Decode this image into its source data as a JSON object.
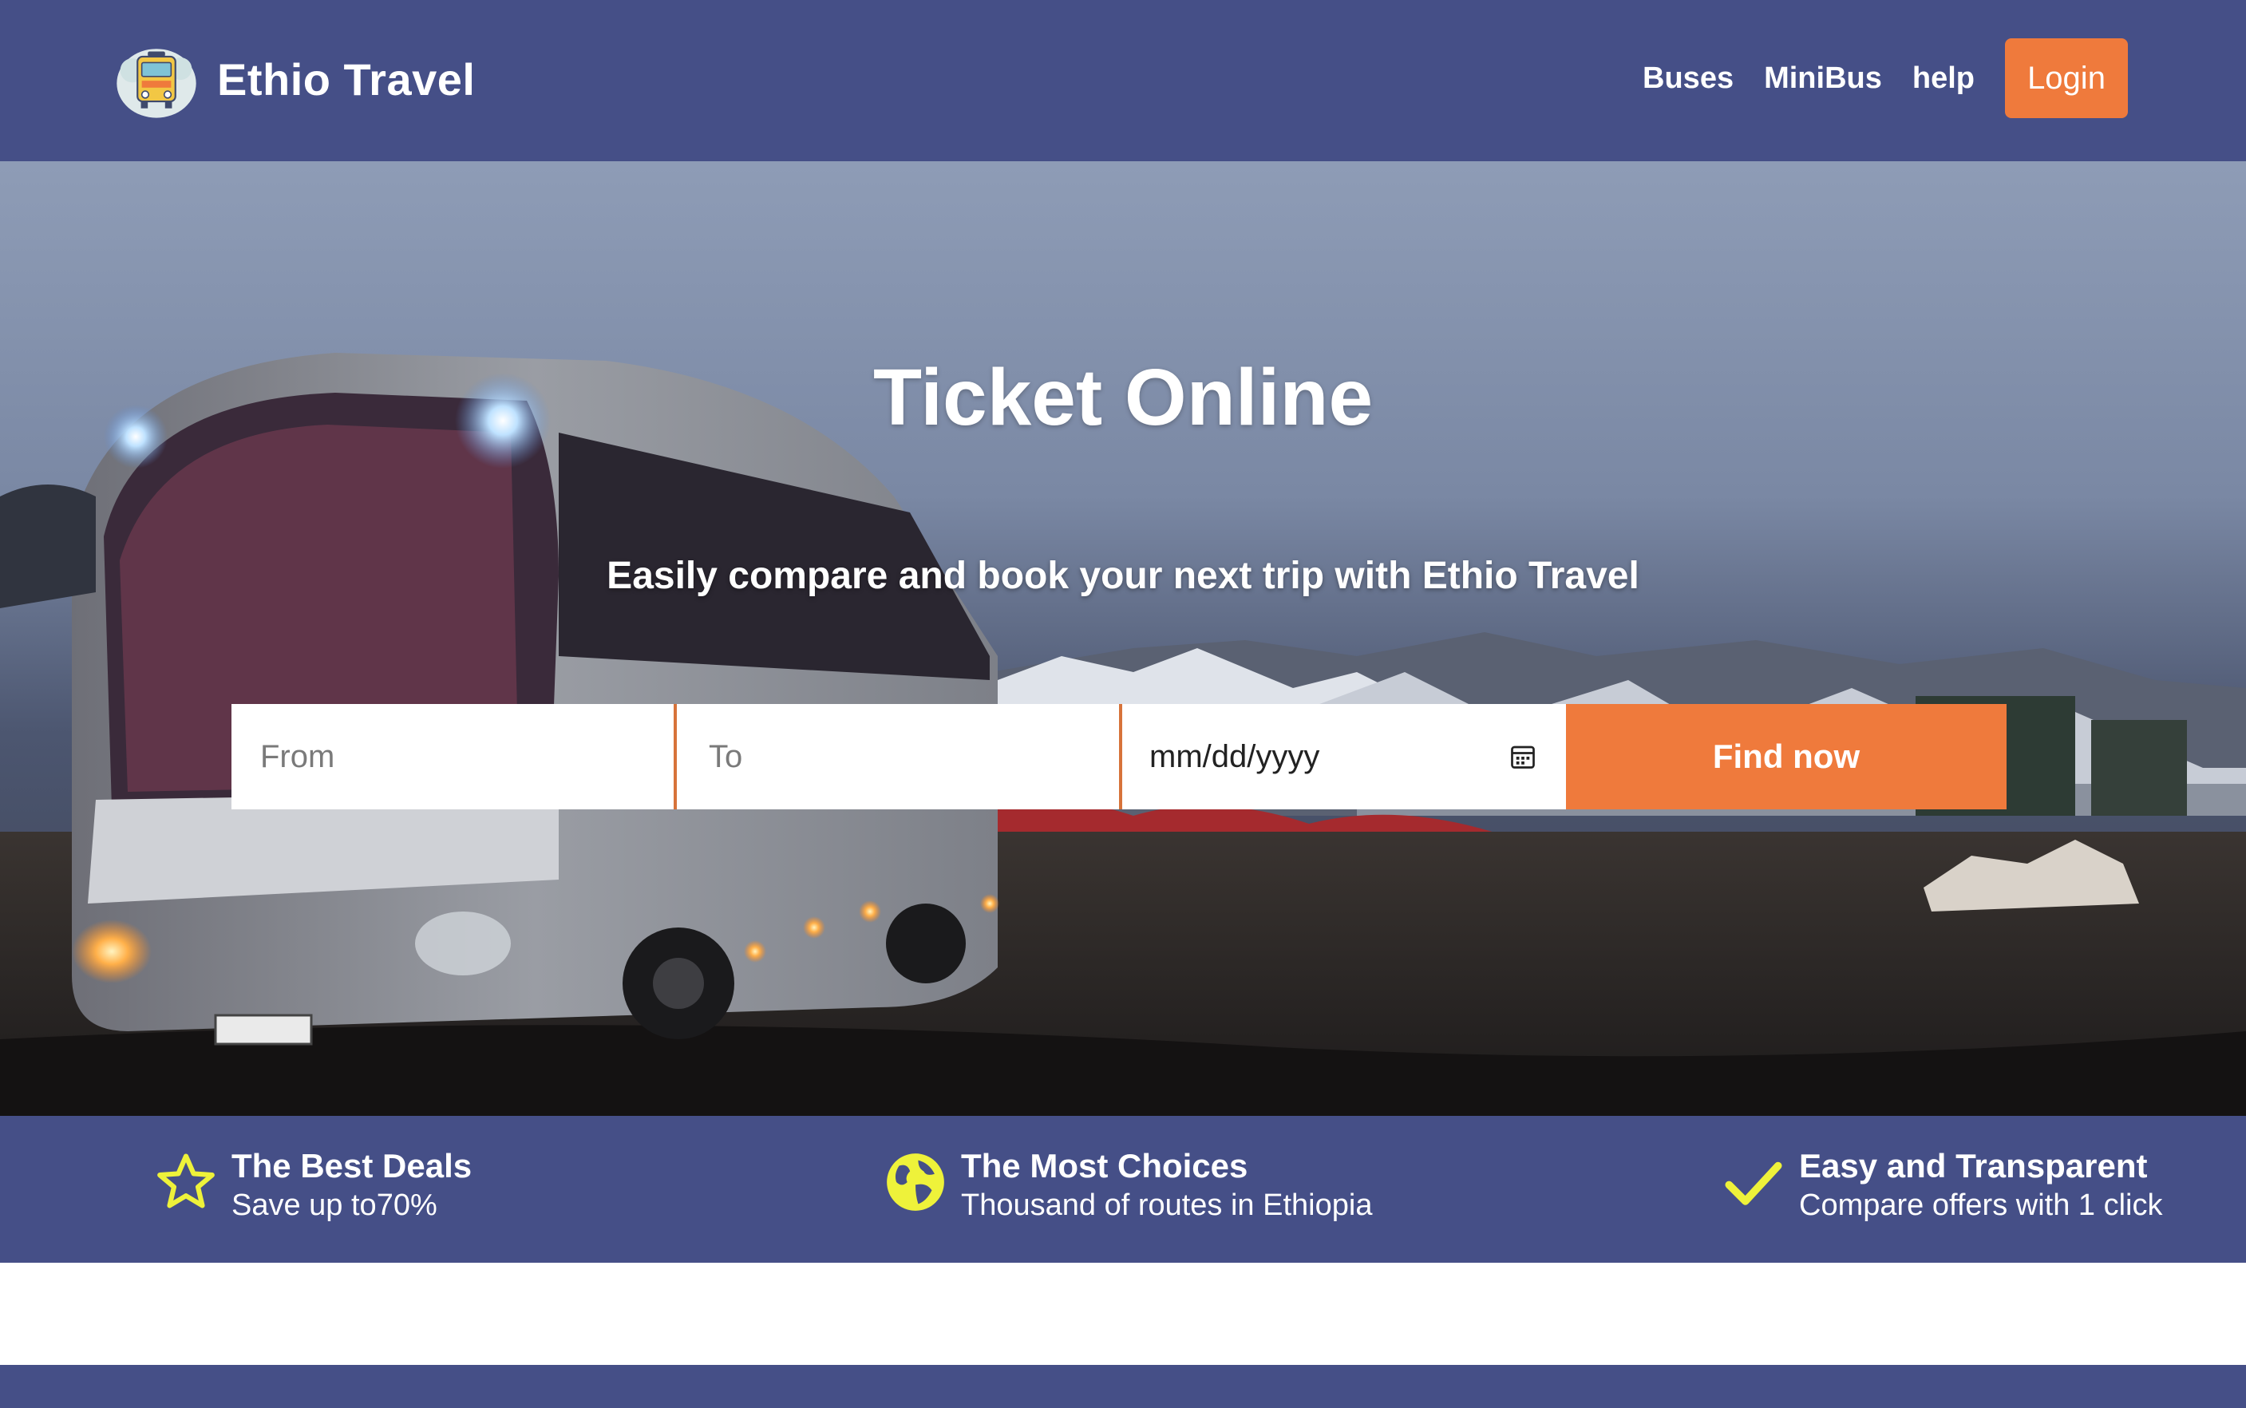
{
  "brand": {
    "name": "Ethio Travel",
    "logo_icon": "bus-logo-icon"
  },
  "nav": {
    "links": [
      "Buses",
      "MiniBus",
      "help"
    ],
    "login_label": "Login"
  },
  "hero": {
    "title": "Ticket Online",
    "subtitle": "Easily compare and book your next trip with Ethio Travel"
  },
  "search": {
    "from_placeholder": "From",
    "to_placeholder": "To",
    "date_value": "mm/dd/yyyy",
    "date_icon": "calendar-icon",
    "find_label": "Find now"
  },
  "features": [
    {
      "icon": "star-icon",
      "title": "The Best Deals",
      "desc": "Save up to70%"
    },
    {
      "icon": "globe-icon",
      "title": "The Most Choices",
      "desc": "Thousand of routes in Ethiopia"
    },
    {
      "icon": "checkmark-icon",
      "title": "Easy and Transparent",
      "desc": "Compare offers with 1 click"
    }
  ],
  "colors": {
    "navbar": "#454f87",
    "accent": "#ef7a3c",
    "icon_yellow": "#eef23a"
  }
}
